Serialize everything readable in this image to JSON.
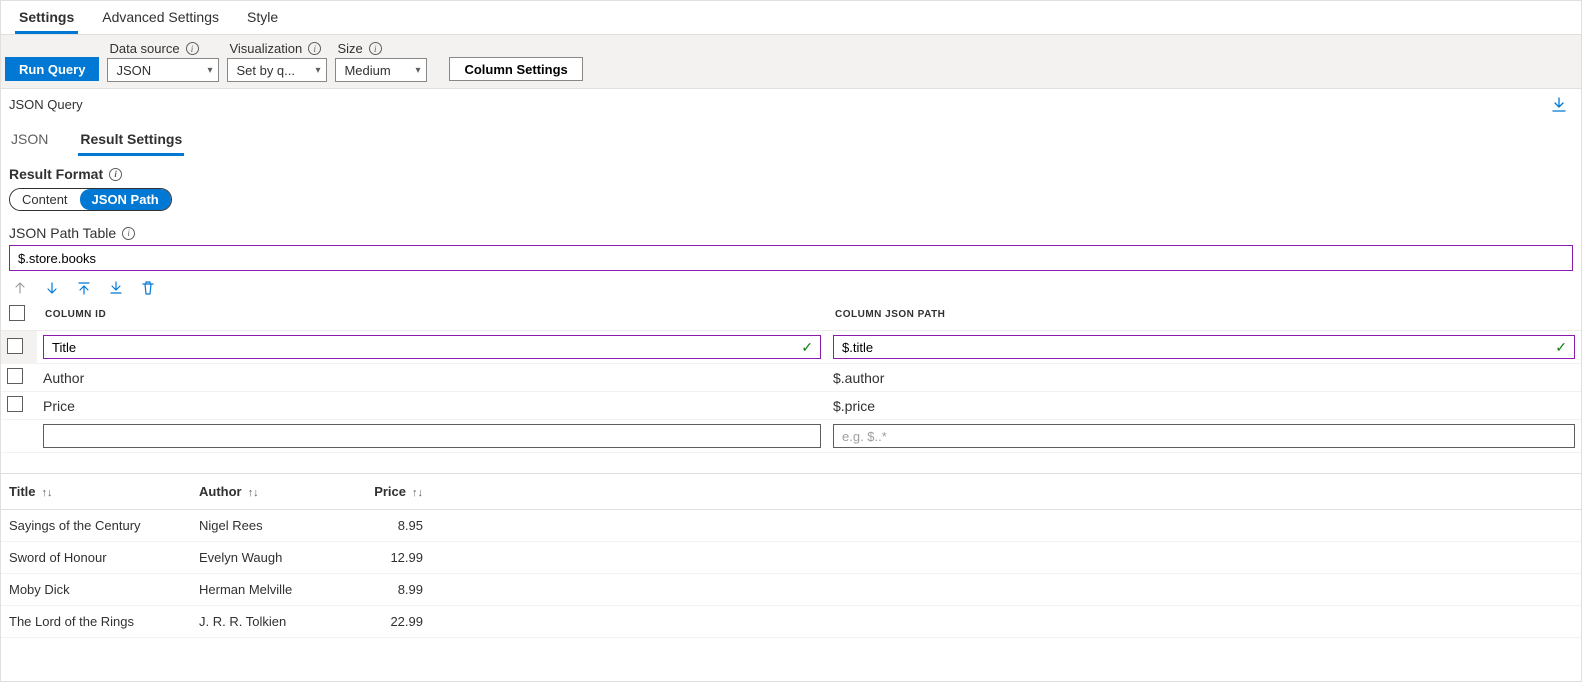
{
  "topTabs": {
    "settings": "Settings",
    "advanced": "Advanced Settings",
    "style": "Style"
  },
  "toolbar": {
    "runQuery": "Run Query",
    "dataSourceLabel": "Data source",
    "dataSourceValue": "JSON",
    "vizLabel": "Visualization",
    "vizValue": "Set by q...",
    "sizeLabel": "Size",
    "sizeValue": "Medium",
    "columnSettings": "Column Settings"
  },
  "sectionHeader": "JSON Query",
  "subTabs": {
    "json": "JSON",
    "resultSettings": "Result Settings"
  },
  "resultFormat": {
    "label": "Result Format",
    "content": "Content",
    "jsonPath": "JSON Path"
  },
  "jsonPathTable": {
    "label": "JSON Path Table",
    "value": "$.store.books"
  },
  "columnsHeader": {
    "id": "COLUMN ID",
    "path": "COLUMN JSON PATH"
  },
  "columns": [
    {
      "id": "Title",
      "path": "$.title",
      "editing": true
    },
    {
      "id": "Author",
      "path": "$.author",
      "editing": false
    },
    {
      "id": "Price",
      "path": "$.price",
      "editing": false
    }
  ],
  "newRowPlaceholder": "e.g. $..*",
  "resultsHeader": {
    "title": "Title",
    "author": "Author",
    "price": "Price"
  },
  "results": [
    {
      "title": "Sayings of the Century",
      "author": "Nigel Rees",
      "price": "8.95"
    },
    {
      "title": "Sword of Honour",
      "author": "Evelyn Waugh",
      "price": "12.99"
    },
    {
      "title": "Moby Dick",
      "author": "Herman Melville",
      "price": "8.99"
    },
    {
      "title": "The Lord of the Rings",
      "author": "J. R. R. Tolkien",
      "price": "22.99"
    }
  ]
}
